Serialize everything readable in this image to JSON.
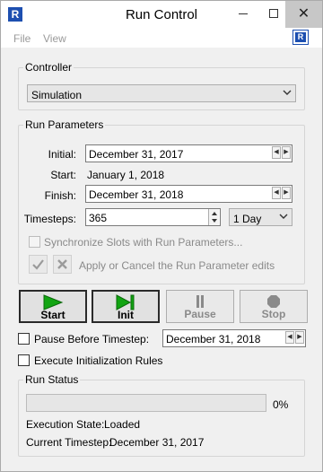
{
  "window": {
    "title": "Run Control"
  },
  "titlebar_controls": {
    "close_glyph": "✕"
  },
  "menu": {
    "items": [
      "File",
      "View"
    ]
  },
  "controller": {
    "group_title": "Controller",
    "selected": "Simulation"
  },
  "run_parameters": {
    "group_title": "Run Parameters",
    "initial_label": "Initial:",
    "initial_value": "December 31, 2017",
    "start_label": "Start:",
    "start_value": "January 1, 2018",
    "finish_label": "Finish:",
    "finish_value": "December 31, 2018",
    "timesteps_label": "Timesteps:",
    "timesteps_value": "365",
    "timestep_unit": "1 Day",
    "sync_label": "Synchronize Slots with Run Parameters...",
    "sync_checked": false,
    "apply_cancel_label": "Apply or Cancel the Run Parameter edits"
  },
  "controls": {
    "start_label": "Start",
    "init_label": "Init",
    "pause_label": "Pause",
    "stop_label": "Stop"
  },
  "options": {
    "pause_before_label": "Pause Before Timestep:",
    "pause_before_checked": false,
    "pause_before_value": "December 31, 2018",
    "init_rules_label": "Execute Initialization Rules",
    "init_rules_checked": false
  },
  "run_status": {
    "group_title": "Run Status",
    "progress_percent": 0,
    "progress_text": "0%",
    "execution_state_label": "Execution State:",
    "execution_state_value": "Loaded",
    "current_timestep_label": "Current Timestep:",
    "current_timestep_value": "December 31, 2017"
  },
  "colors": {
    "accent_green": "#12a512",
    "brand_blue": "#1d4fb0",
    "disabled_gray": "#8a8a8a"
  },
  "icons": {
    "app": "riverware-r-icon",
    "apply": "check-icon",
    "cancel": "x-icon",
    "start": "play-icon",
    "init": "step-icon",
    "pause": "pause-icon",
    "stop": "stop-icon"
  }
}
